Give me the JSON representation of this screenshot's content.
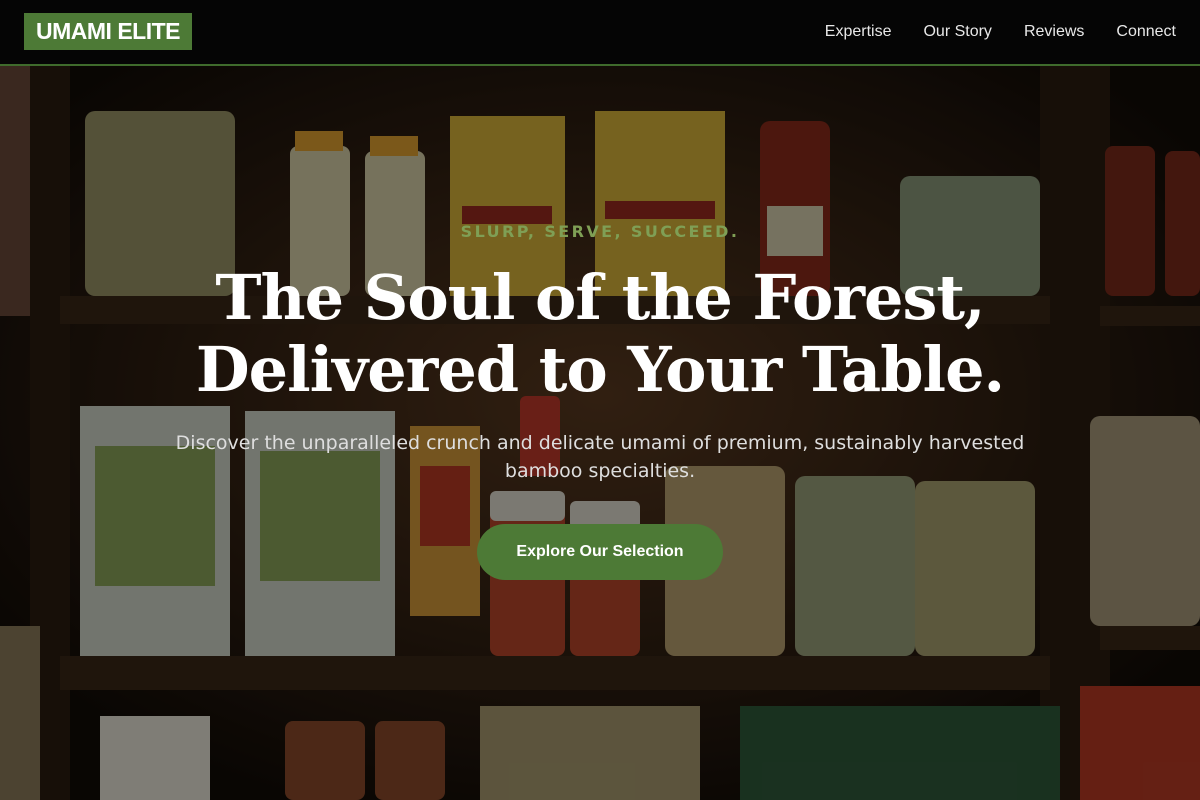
{
  "header": {
    "logo": "UMAMI ELITE",
    "nav": [
      "Expertise",
      "Our Story",
      "Reviews",
      "Connect"
    ]
  },
  "hero": {
    "tagline": "SLURP, SERVE, SUCCEED.",
    "headline_line1": "The Soul of the Forest,",
    "headline_line2": "Delivered to Your Table.",
    "subtitle": "Discover the unparalleled crunch and delicate umami of premium, sustainably harvested bamboo specialties.",
    "cta_label": "Explore Our Selection",
    "background": "pantry shelves stocked with pasta, polenta and sauces"
  },
  "colors": {
    "accent": "#4d7a36",
    "tagline": "#7f9f55",
    "header_bg": "#050505"
  }
}
